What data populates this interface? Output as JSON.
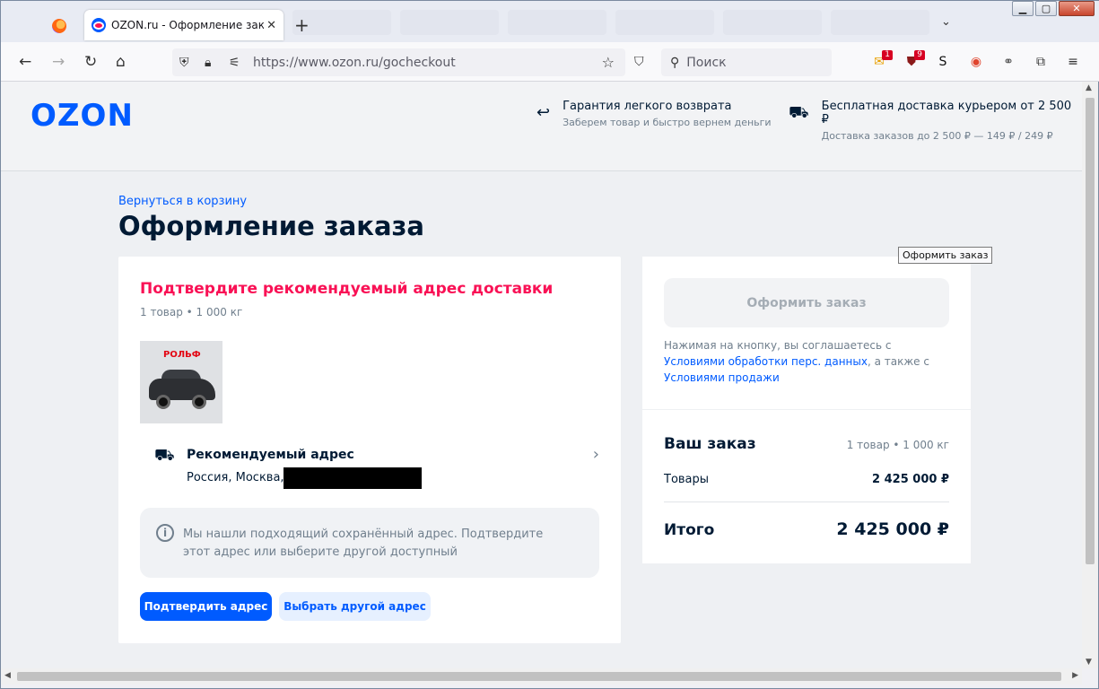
{
  "browser": {
    "tab_title": "OZON.ru - Оформление заказа",
    "tab_close": "✕",
    "new_tab": "+",
    "url": "https://www.ozon.ru/gocheckout",
    "search_placeholder": "Поиск",
    "window_buttons": {
      "minimize": "▁",
      "maximize": "▢",
      "close": "✕"
    },
    "extensions": [
      {
        "name": "mail-extension-icon",
        "glyph": "✉",
        "color": "#e8a000",
        "badge": "1"
      },
      {
        "name": "shield-extension-icon",
        "glyph": "⛊",
        "color": "#8b1a1a",
        "badge": "9"
      },
      {
        "name": "s-extension-icon",
        "glyph": "S",
        "color": "#111111"
      },
      {
        "name": "camera-extension-icon",
        "glyph": "◉",
        "color": "#e0452e"
      },
      {
        "name": "cycle-extension-icon",
        "glyph": "⚭",
        "color": "#555555"
      },
      {
        "name": "puzzle-extension-icon",
        "glyph": "⧉",
        "color": "#333333"
      },
      {
        "name": "menu-icon",
        "glyph": "≡",
        "color": "#333333"
      }
    ]
  },
  "header": {
    "logo": "OZON",
    "promo_return": {
      "title": "Гарантия легкого возврата",
      "subtitle": "Заберем товар и быстро вернем деньги"
    },
    "promo_delivery": {
      "title": "Бесплатная доставка курьером от 2 500 ₽",
      "subtitle": "Доставка заказов до 2 500 ₽ — 149 ₽ / 249 ₽"
    }
  },
  "page": {
    "back_link": "Вернуться в корзину",
    "title": "Оформление заказа"
  },
  "delivery": {
    "warning_title": "Подтвердите рекомендуемый адрес доставки",
    "meta": "1 товар • 1 000 кг",
    "product_brand": "РОЛЬФ",
    "address_title": "Рекомендуемый адрес",
    "address_value": "Россия, Москва,",
    "info_text": "Мы нашли подходящий сохранённый адрес. Подтвердите этот адрес или выберите другой доступный",
    "confirm_button": "Подтвердить адрес",
    "choose_button": "Выбрать другой адрес"
  },
  "checkout": {
    "button": "Оформить заказ",
    "tooltip": "Оформить заказ",
    "consent_prefix": "Нажимая на кнопку, вы соглашаетесь с",
    "consent_link1": "Условиями обработки перс. данных",
    "consent_middle": ", а также с",
    "consent_link2": "Условиями продажи"
  },
  "summary": {
    "title": "Ваш заказ",
    "meta": "1 товар • 1 000 кг",
    "goods_label": "Товары",
    "goods_value": "2 425 000 ₽",
    "total_label": "Итого",
    "total_value": "2 425 000 ₽"
  },
  "colors": {
    "brand": "#005bff",
    "accent_warning": "#f91155",
    "text_primary": "#001a34",
    "text_secondary": "#707f8d"
  }
}
